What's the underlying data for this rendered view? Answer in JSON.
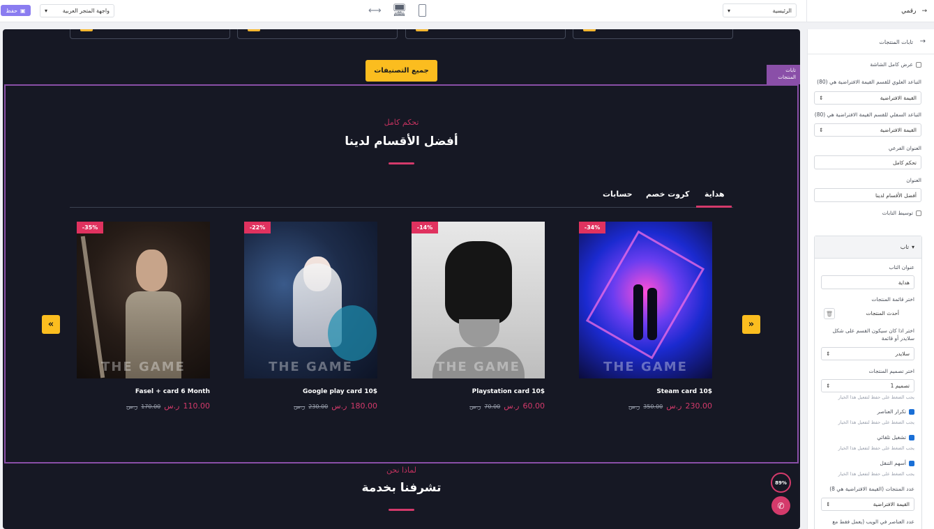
{
  "topbar": {
    "save_label": "حفظ",
    "store_select": "واجهة المتجر العربية",
    "page_select": "الرئيسية",
    "section_title": "رقمي"
  },
  "canvas": {
    "all_categories_button": "جميع التصنيفات",
    "section_badge": "تابات المنتجات",
    "section": {
      "subtitle": "تحكم كامل",
      "title": "أفضل الأقسام لدينا",
      "tabs": [
        "هداية",
        "كروت خصم",
        "حسابات"
      ],
      "currency": "ر.س",
      "products": [
        {
          "name": "Steam card 10$",
          "discount": "-34%",
          "price": "230.00",
          "old_price": "350.00",
          "watermark": "THE GAME"
        },
        {
          "name": "Playstation card 10$",
          "discount": "-14%",
          "price": "60.00",
          "old_price": "70.00",
          "watermark": "THE GAME"
        },
        {
          "name": "Google play card 10$",
          "discount": "-22%",
          "price": "180.00",
          "old_price": "230.00",
          "watermark": "THE GAME"
        },
        {
          "name": "Fasel + card 6 Month",
          "discount": "-35%",
          "price": "110.00",
          "old_price": "170.00",
          "watermark": "THE GAME"
        }
      ]
    },
    "next_section": {
      "subtitle": "لماذا نحن",
      "title": "تشرفنا بخدمة"
    },
    "scroll_progress": "89%"
  },
  "panel": {
    "back_title": "تابات المنتجات",
    "full_width_label": "عرض كامل الشاشة",
    "top_padding_label": "التباعد العلوي للقسم القيمة الافتراضية هي (80)",
    "top_padding_value": "القيمة الافتراضية",
    "bottom_padding_label": "التباعد السفلي للقسم القيمة الافتراضية هي (80)",
    "bottom_padding_value": "القيمة الافتراضية",
    "subtitle_label": "العنوان الفرعي",
    "subtitle_value": "تحكم كامل",
    "title_label": "العنوان",
    "title_value": "أفضل الأقسام لدينا",
    "center_tabs_label": "توسيط التابات",
    "accordion_title": "تاب",
    "tab_title_label": "عنوان التاب",
    "tab_title_value": "هداية",
    "product_list_label": "اختر قائمة المنتجات",
    "product_list_value": "أحدث المنتجات",
    "display_mode_label": "اختر اذا كان سيكون القسم على شكل سلايدر أو قائمة",
    "display_mode_value": "سلايدر",
    "design_label": "اختر تصميم المنتجات",
    "design_value": "تصميم 1",
    "hint_text": "يجب الضغط على حفظ لتفعيل هذا الخيار",
    "repeat_label": "تكرار العناصر",
    "autoplay_label": "تشغيل تلقائي",
    "nav_arrows_label": "أسهم التنقل",
    "count_label": "عدد المنتجات (القيمة الافتراضية هي 8)",
    "count_value": "القيمة الافتراضية",
    "web_count_label": "عدد العناصر في الويب (يعمل فقط مع"
  }
}
